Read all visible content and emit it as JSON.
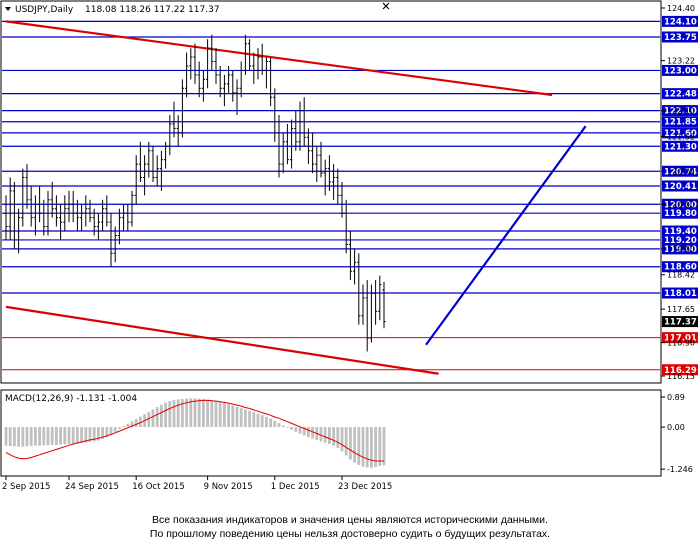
{
  "header": {
    "symbol": "USDJPY,Daily",
    "ohlc": "118.08 118.26 117.22 117.37"
  },
  "macd": {
    "label": "MACD(12,26,9) -1.131 -1.004",
    "ticks": [
      {
        "label": "0.89",
        "value": 0.89
      },
      {
        "label": "0.00",
        "value": 0.0
      },
      {
        "label": "-1.246",
        "value": -1.246
      }
    ],
    "histogram_color": "#c0c0c0",
    "signal_color": "#e00000"
  },
  "disclaimer": {
    "line1": "Все показания индикаторов и значения цены являются историческими данными.",
    "line2": "По прошлому поведению цены нельзя достоверно судить о будущих результатах."
  },
  "chart_data": {
    "type": "candlestick",
    "symbol": "USDJPY",
    "timeframe": "Daily",
    "ylim": [
      116.15,
      124.4
    ],
    "x_tick_labels": [
      "2 Sep 2015",
      "24 Sep 2015",
      "16 Oct 2015",
      "9 Nov 2015",
      "1 Dec 2015",
      "23 Dec 2015"
    ],
    "price_axis_labels": [
      {
        "label": "124.40",
        "value": 124.4
      },
      {
        "label": "123.22",
        "value": 123.22
      },
      {
        "label": "122.10",
        "value": 122.1
      },
      {
        "label": "121.52",
        "value": 121.52
      },
      {
        "label": "120.74",
        "value": 120.74
      },
      {
        "label": "120.00",
        "value": 120.0
      },
      {
        "label": "119.00",
        "value": 119.0
      },
      {
        "label": "118.42",
        "value": 118.42
      },
      {
        "label": "117.65",
        "value": 117.65
      },
      {
        "label": "116.90",
        "value": 116.9
      },
      {
        "label": "116.15",
        "value": 116.15
      }
    ],
    "levels": [
      {
        "label": "124.10",
        "value": 124.1,
        "color": "#0000cc"
      },
      {
        "label": "123.75",
        "value": 123.75,
        "color": "#0000cc"
      },
      {
        "label": "123.00",
        "value": 123.0,
        "color": "#0000cc"
      },
      {
        "label": "122.48",
        "value": 122.48,
        "color": "#0000cc"
      },
      {
        "label": "122.10",
        "value": 122.1,
        "color": "#0000cc"
      },
      {
        "label": "121.85",
        "value": 121.85,
        "color": "#0000cc"
      },
      {
        "label": "121.60",
        "value": 121.6,
        "color": "#0000cc"
      },
      {
        "label": "121.30",
        "value": 121.3,
        "color": "#0000cc"
      },
      {
        "label": "120.74",
        "value": 120.74,
        "color": "#0000cc"
      },
      {
        "label": "120.41",
        "value": 120.41,
        "color": "#0000cc"
      },
      {
        "label": "120.00",
        "value": 120.0,
        "color": "#0000cc"
      },
      {
        "label": "119.80",
        "value": 119.8,
        "color": "#0000cc"
      },
      {
        "label": "119.40",
        "value": 119.4,
        "color": "#0000cc"
      },
      {
        "label": "119.20",
        "value": 119.2,
        "color": "#0000cc"
      },
      {
        "label": "119.00",
        "value": 119.0,
        "color": "#0000cc"
      },
      {
        "label": "118.60",
        "value": 118.6,
        "color": "#0000cc"
      },
      {
        "label": "118.01",
        "value": 118.01,
        "color": "#0000cc"
      },
      {
        "label": "117.37",
        "value": 117.37,
        "color": "#000000"
      },
      {
        "label": "117.01",
        "value": 117.01,
        "color": "#dd0000"
      },
      {
        "label": "116.29",
        "value": 116.29,
        "color": "#dd0000"
      }
    ],
    "trendlines": [
      {
        "color": "#dd0000",
        "points": [
          [
            0,
            124.1
          ],
          [
            130,
            122.45
          ]
        ]
      },
      {
        "color": "#dd0000",
        "points": [
          [
            0,
            117.7
          ],
          [
            103,
            116.2
          ]
        ]
      },
      {
        "color": "#0000cc",
        "points": [
          [
            100,
            116.85
          ],
          [
            138,
            121.75
          ]
        ]
      }
    ],
    "candles": [
      [
        119.8,
        120.2,
        119.2,
        119.5
      ],
      [
        119.5,
        120.6,
        119.2,
        120.3
      ],
      [
        120.3,
        120.5,
        119.0,
        119.2
      ],
      [
        119.2,
        119.9,
        118.9,
        119.7
      ],
      [
        119.7,
        120.8,
        119.5,
        120.6
      ],
      [
        120.6,
        120.9,
        119.9,
        120.1
      ],
      [
        120.1,
        120.4,
        119.5,
        119.7
      ],
      [
        119.7,
        120.2,
        119.3,
        120.0
      ],
      [
        120.0,
        120.4,
        119.6,
        119.8
      ],
      [
        119.8,
        120.1,
        119.3,
        119.5
      ],
      [
        119.5,
        120.3,
        119.3,
        120.1
      ],
      [
        120.1,
        120.5,
        119.7,
        119.9
      ],
      [
        119.9,
        120.2,
        119.5,
        119.7
      ],
      [
        119.7,
        120.0,
        119.2,
        119.6
      ],
      [
        119.6,
        120.2,
        119.4,
        119.9
      ],
      [
        119.9,
        120.3,
        119.6,
        120.0
      ],
      [
        120.0,
        120.3,
        119.6,
        119.8
      ],
      [
        119.8,
        120.1,
        119.4,
        119.7
      ],
      [
        119.7,
        120.0,
        119.4,
        119.8
      ],
      [
        119.8,
        120.2,
        119.5,
        119.9
      ],
      [
        119.9,
        120.1,
        119.6,
        119.7
      ],
      [
        119.7,
        119.9,
        119.3,
        119.5
      ],
      [
        119.5,
        119.8,
        119.2,
        119.6
      ],
      [
        119.6,
        120.1,
        119.4,
        119.9
      ],
      [
        119.9,
        120.2,
        119.5,
        119.6
      ],
      [
        119.6,
        119.8,
        118.6,
        118.9
      ],
      [
        118.9,
        119.5,
        118.7,
        119.3
      ],
      [
        119.3,
        119.9,
        119.1,
        119.7
      ],
      [
        119.7,
        120.0,
        119.4,
        119.8
      ],
      [
        119.8,
        120.0,
        119.4,
        119.6
      ],
      [
        119.6,
        120.3,
        119.5,
        120.2
      ],
      [
        120.2,
        121.1,
        120.0,
        120.9
      ],
      [
        120.9,
        121.4,
        120.5,
        120.6
      ],
      [
        120.6,
        121.1,
        120.2,
        120.9
      ],
      [
        120.9,
        121.4,
        120.6,
        121.2
      ],
      [
        121.2,
        121.3,
        120.5,
        120.6
      ],
      [
        120.6,
        121.1,
        120.4,
        120.8
      ],
      [
        120.8,
        121.2,
        120.3,
        121.0
      ],
      [
        121.0,
        121.4,
        120.8,
        121.3
      ],
      [
        121.3,
        122.0,
        121.1,
        121.8
      ],
      [
        121.8,
        122.3,
        121.5,
        121.7
      ],
      [
        121.7,
        122.0,
        121.3,
        121.6
      ],
      [
        121.6,
        122.8,
        121.5,
        122.6
      ],
      [
        122.6,
        123.4,
        122.4,
        123.1
      ],
      [
        123.1,
        123.5,
        122.8,
        123.3
      ],
      [
        123.3,
        123.6,
        122.7,
        122.9
      ],
      [
        122.9,
        123.2,
        122.4,
        122.6
      ],
      [
        122.6,
        123.0,
        122.3,
        122.8
      ],
      [
        122.8,
        123.7,
        122.6,
        123.5
      ],
      [
        123.5,
        123.8,
        123.0,
        123.2
      ],
      [
        123.2,
        123.5,
        122.7,
        122.9
      ],
      [
        122.9,
        123.1,
        122.4,
        122.6
      ],
      [
        122.6,
        122.9,
        122.2,
        122.7
      ],
      [
        122.7,
        123.1,
        122.5,
        122.9
      ],
      [
        122.9,
        123.0,
        122.3,
        122.5
      ],
      [
        122.5,
        122.8,
        122.0,
        122.6
      ],
      [
        122.6,
        123.2,
        122.4,
        123.0
      ],
      [
        123.0,
        123.8,
        122.9,
        123.6
      ],
      [
        123.6,
        123.7,
        123.0,
        123.1
      ],
      [
        123.1,
        123.4,
        122.7,
        123.0
      ],
      [
        123.0,
        123.5,
        122.8,
        123.3
      ],
      [
        123.3,
        123.6,
        122.9,
        123.0
      ],
      [
        123.0,
        123.3,
        122.6,
        123.2
      ],
      [
        123.2,
        123.3,
        122.2,
        122.4
      ],
      [
        122.4,
        122.6,
        121.4,
        121.6
      ],
      [
        121.6,
        122.0,
        120.6,
        120.9
      ],
      [
        120.9,
        121.6,
        120.7,
        121.4
      ],
      [
        121.4,
        121.8,
        120.9,
        121.0
      ],
      [
        121.0,
        121.9,
        120.8,
        121.7
      ],
      [
        121.7,
        122.1,
        121.2,
        121.4
      ],
      [
        121.4,
        122.3,
        121.2,
        122.1
      ],
      [
        122.1,
        122.4,
        121.3,
        121.5
      ],
      [
        121.5,
        121.7,
        120.9,
        121.2
      ],
      [
        121.2,
        121.6,
        120.7,
        120.9
      ],
      [
        120.9,
        121.3,
        120.5,
        121.1
      ],
      [
        121.1,
        121.4,
        120.6,
        120.7
      ],
      [
        120.7,
        121.0,
        120.2,
        120.8
      ],
      [
        120.8,
        121.1,
        120.3,
        120.5
      ],
      [
        120.5,
        120.9,
        120.1,
        120.6
      ],
      [
        120.6,
        120.8,
        120.0,
        120.2
      ],
      [
        120.2,
        120.5,
        119.7,
        119.8
      ],
      [
        119.8,
        120.1,
        118.9,
        119.1
      ],
      [
        119.1,
        119.4,
        118.3,
        118.5
      ],
      [
        118.5,
        119.0,
        118.2,
        118.7
      ],
      [
        118.7,
        118.9,
        117.3,
        117.5
      ],
      [
        117.5,
        118.2,
        117.3,
        117.9
      ],
      [
        117.9,
        118.3,
        116.7,
        117.0
      ],
      [
        117.0,
        118.2,
        116.9,
        118.0
      ],
      [
        118.0,
        118.3,
        117.3,
        117.6
      ],
      [
        117.6,
        118.4,
        117.4,
        118.2
      ],
      [
        118.08,
        118.26,
        117.22,
        117.37
      ]
    ],
    "macd_histogram": [
      -0.55,
      -0.56,
      -0.57,
      -0.58,
      -0.58,
      -0.57,
      -0.56,
      -0.55,
      -0.55,
      -0.54,
      -0.54,
      -0.53,
      -0.53,
      -0.52,
      -0.51,
      -0.5,
      -0.49,
      -0.48,
      -0.47,
      -0.46,
      -0.44,
      -0.42,
      -0.4,
      -0.36,
      -0.3,
      -0.22,
      -0.14,
      -0.06,
      0.02,
      0.1,
      0.17,
      0.24,
      0.31,
      0.38,
      0.45,
      0.52,
      0.59,
      0.66,
      0.72,
      0.77,
      0.8,
      0.82,
      0.83,
      0.84,
      0.85,
      0.85,
      0.84,
      0.83,
      0.82,
      0.8,
      0.78,
      0.75,
      0.72,
      0.68,
      0.64,
      0.6,
      0.56,
      0.52,
      0.48,
      0.44,
      0.4,
      0.35,
      0.3,
      0.25,
      0.19,
      0.12,
      0.05,
      -0.02,
      -0.08,
      -0.14,
      -0.2,
      -0.25,
      -0.3,
      -0.34,
      -0.38,
      -0.42,
      -0.46,
      -0.5,
      -0.55,
      -0.62,
      -0.72,
      -0.84,
      -0.96,
      -1.05,
      -1.12,
      -1.17,
      -1.19,
      -1.2,
      -1.18,
      -1.15,
      -1.131
    ],
    "macd_signal": [
      -0.75,
      -0.82,
      -0.88,
      -0.92,
      -0.94,
      -0.93,
      -0.9,
      -0.86,
      -0.82,
      -0.78,
      -0.74,
      -0.7,
      -0.66,
      -0.62,
      -0.58,
      -0.54,
      -0.5,
      -0.47,
      -0.44,
      -0.41,
      -0.38,
      -0.36,
      -0.33,
      -0.3,
      -0.26,
      -0.22,
      -0.17,
      -0.12,
      -0.07,
      -0.02,
      0.03,
      0.08,
      0.13,
      0.19,
      0.25,
      0.31,
      0.37,
      0.43,
      0.49,
      0.55,
      0.6,
      0.65,
      0.69,
      0.72,
      0.75,
      0.77,
      0.78,
      0.79,
      0.79,
      0.78,
      0.77,
      0.75,
      0.73,
      0.71,
      0.68,
      0.65,
      0.62,
      0.58,
      0.55,
      0.51,
      0.47,
      0.43,
      0.39,
      0.35,
      0.3,
      0.26,
      0.21,
      0.16,
      0.11,
      0.06,
      0.01,
      -0.04,
      -0.09,
      -0.14,
      -0.19,
      -0.24,
      -0.29,
      -0.34,
      -0.39,
      -0.45,
      -0.52,
      -0.6,
      -0.68,
      -0.76,
      -0.83,
      -0.89,
      -0.94,
      -0.98,
      -1.0,
      -1.003,
      -1.004
    ]
  }
}
